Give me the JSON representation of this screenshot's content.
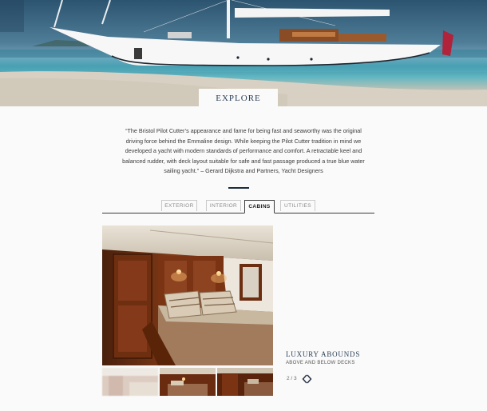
{
  "hero": {
    "explore_label": "EXPLORE"
  },
  "quote": {
    "text": "“The Bristol Pilot Cutter’s appearance and fame for being fast and seaworthy was the original driving force behind the Emmaline design. While keeping the Pilot Cutter tradition in mind we developed a yacht with modern standards of performance and comfort. A retractable keel and balanced rudder, with deck layout suitable for safe and fast passage produced a true blue water sailing yacht.” – Gerard Dijkstra and Partners, Yacht Designers"
  },
  "tabs": [
    {
      "label": "EXTERIOR",
      "active": false
    },
    {
      "label": "INTERIOR",
      "active": false
    },
    {
      "label": "CABINS",
      "active": true
    },
    {
      "label": "UTILITIES",
      "active": false
    }
  ],
  "gallery": {
    "caption_title": "LUXURY ABOUNDS",
    "caption_subtitle": "ABOVE AND BELOW DECKS",
    "counter": "2 / 3",
    "prev_icon": "chevron-left-icon",
    "next_icon": "chevron-right-icon"
  },
  "colors": {
    "accent_navy": "#1d2b3c",
    "title_blue": "#2a3e55",
    "page_bg": "#fafafa"
  }
}
